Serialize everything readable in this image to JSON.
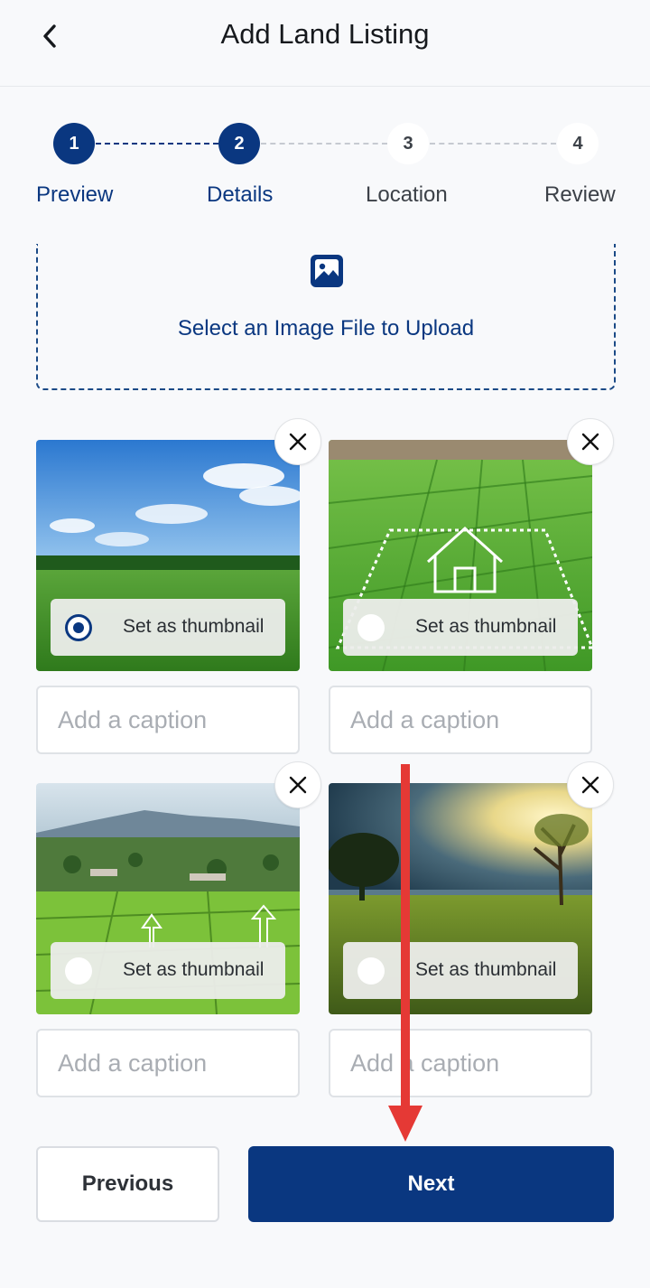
{
  "header": {
    "title": "Add Land Listing",
    "back_icon": "chevron-left-icon"
  },
  "stepper": {
    "current_step": 2,
    "steps": [
      {
        "number": "1",
        "label": "Preview",
        "state": "active"
      },
      {
        "number": "2",
        "label": "Details",
        "state": "active"
      },
      {
        "number": "3",
        "label": "Location",
        "state": "inactive"
      },
      {
        "number": "4",
        "label": "Review",
        "state": "inactive"
      }
    ]
  },
  "upload": {
    "label": "Select an Image File to Upload",
    "icon": "image-icon"
  },
  "photos": [
    {
      "scene": "green-meadow-blue-sky",
      "thumbnail_label": "Set as thumbnail",
      "is_thumbnail": true,
      "caption_placeholder": "Add a caption",
      "caption_value": ""
    },
    {
      "scene": "rice-field-house-outline",
      "thumbnail_label": "Set as thumbnail",
      "is_thumbnail": false,
      "caption_placeholder": "Add a caption",
      "caption_value": ""
    },
    {
      "scene": "aerial-farmland-village",
      "thumbnail_label": "Set as thumbnail",
      "is_thumbnail": false,
      "caption_placeholder": "Add a caption",
      "caption_value": ""
    },
    {
      "scene": "sunset-tree-field",
      "thumbnail_label": "Set as thumbnail",
      "is_thumbnail": false,
      "caption_placeholder": "Add a caption",
      "caption_value": ""
    }
  ],
  "footer": {
    "previous_label": "Previous",
    "next_label": "Next"
  },
  "colors": {
    "primary": "#0a3780",
    "annotation_arrow": "#e53935",
    "background": "#f8f9fb"
  }
}
